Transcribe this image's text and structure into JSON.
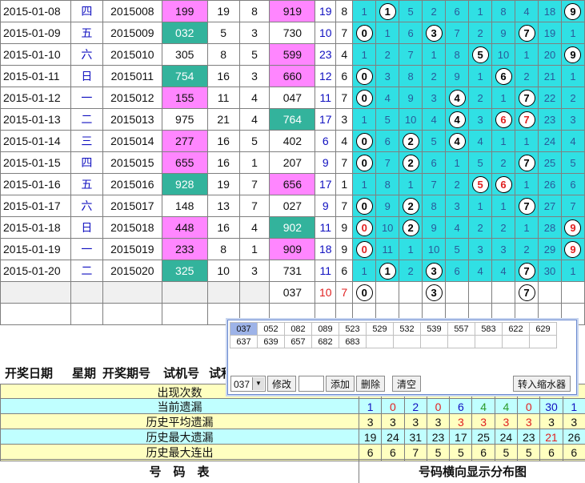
{
  "rows": [
    {
      "date": "2015-01-08",
      "week": "四",
      "issue": "2015008",
      "test": "199",
      "test_bg": "pink",
      "s": "19",
      "k": "8",
      "draw": "919",
      "draw_bg": "pink",
      "ds": "19",
      "dk": "8",
      "dist": [
        {
          "v": "1"
        },
        {
          "v": "1",
          "c": 1
        },
        {
          "v": "5"
        },
        {
          "v": "2"
        },
        {
          "v": "6"
        },
        {
          "v": "1"
        },
        {
          "v": "8"
        },
        {
          "v": "4"
        },
        {
          "v": "18"
        },
        {
          "v": "9",
          "c": 1
        }
      ]
    },
    {
      "date": "2015-01-09",
      "week": "五",
      "issue": "2015009",
      "test": "032",
      "test_bg": "teal",
      "s": "5",
      "k": "3",
      "draw": "730",
      "draw_bg": "",
      "ds": "10",
      "dk": "7",
      "dist": [
        {
          "v": "0",
          "c": 1
        },
        {
          "v": "1"
        },
        {
          "v": "6"
        },
        {
          "v": "3",
          "c": 1
        },
        {
          "v": "7"
        },
        {
          "v": "2"
        },
        {
          "v": "9"
        },
        {
          "v": "7",
          "c": 1
        },
        {
          "v": "19"
        },
        {
          "v": "1"
        }
      ]
    },
    {
      "date": "2015-01-10",
      "week": "六",
      "issue": "2015010",
      "test": "305",
      "test_bg": "",
      "s": "8",
      "k": "5",
      "draw": "599",
      "draw_bg": "pink",
      "ds": "23",
      "dk": "4",
      "dist": [
        {
          "v": "1"
        },
        {
          "v": "2"
        },
        {
          "v": "7"
        },
        {
          "v": "1"
        },
        {
          "v": "8"
        },
        {
          "v": "5",
          "c": 1
        },
        {
          "v": "10"
        },
        {
          "v": "1"
        },
        {
          "v": "20"
        },
        {
          "v": "9",
          "c": 1
        }
      ]
    },
    {
      "date": "2015-01-11",
      "week": "日",
      "issue": "2015011",
      "test": "754",
      "test_bg": "teal",
      "s": "16",
      "k": "3",
      "draw": "660",
      "draw_bg": "pink",
      "ds": "12",
      "dk": "6",
      "dist": [
        {
          "v": "0",
          "c": 1
        },
        {
          "v": "3"
        },
        {
          "v": "8"
        },
        {
          "v": "2"
        },
        {
          "v": "9"
        },
        {
          "v": "1"
        },
        {
          "v": "6",
          "c": 1
        },
        {
          "v": "2"
        },
        {
          "v": "21"
        },
        {
          "v": "1"
        }
      ]
    },
    {
      "date": "2015-01-12",
      "week": "一",
      "issue": "2015012",
      "test": "155",
      "test_bg": "pink",
      "s": "11",
      "k": "4",
      "draw": "047",
      "draw_bg": "",
      "ds": "11",
      "dk": "7",
      "dist": [
        {
          "v": "0",
          "c": 1
        },
        {
          "v": "4"
        },
        {
          "v": "9"
        },
        {
          "v": "3"
        },
        {
          "v": "4",
          "c": 1
        },
        {
          "v": "2"
        },
        {
          "v": "1"
        },
        {
          "v": "7",
          "c": 1
        },
        {
          "v": "22"
        },
        {
          "v": "2"
        }
      ]
    },
    {
      "date": "2015-01-13",
      "week": "二",
      "issue": "2015013",
      "test": "975",
      "test_bg": "",
      "s": "21",
      "k": "4",
      "draw": "764",
      "draw_bg": "teal",
      "ds": "17",
      "dk": "3",
      "dist": [
        {
          "v": "1"
        },
        {
          "v": "5"
        },
        {
          "v": "10"
        },
        {
          "v": "4"
        },
        {
          "v": "4",
          "c": 1
        },
        {
          "v": "3"
        },
        {
          "v": "6",
          "c": 1,
          "r": 1
        },
        {
          "v": "7",
          "c": 1,
          "r": 1
        },
        {
          "v": "23"
        },
        {
          "v": "3"
        }
      ]
    },
    {
      "date": "2015-01-14",
      "week": "三",
      "issue": "2015014",
      "test": "277",
      "test_bg": "pink",
      "s": "16",
      "k": "5",
      "draw": "402",
      "draw_bg": "",
      "ds": "6",
      "dk": "4",
      "dist": [
        {
          "v": "0",
          "c": 1
        },
        {
          "v": "6"
        },
        {
          "v": "2",
          "c": 1
        },
        {
          "v": "5"
        },
        {
          "v": "4",
          "c": 1
        },
        {
          "v": "4"
        },
        {
          "v": "1"
        },
        {
          "v": "1"
        },
        {
          "v": "24"
        },
        {
          "v": "4"
        }
      ]
    },
    {
      "date": "2015-01-15",
      "week": "四",
      "issue": "2015015",
      "test": "655",
      "test_bg": "pink",
      "s": "16",
      "k": "1",
      "draw": "207",
      "draw_bg": "",
      "ds": "9",
      "dk": "7",
      "dist": [
        {
          "v": "0",
          "c": 1
        },
        {
          "v": "7"
        },
        {
          "v": "2",
          "c": 1
        },
        {
          "v": "6"
        },
        {
          "v": "1"
        },
        {
          "v": "5"
        },
        {
          "v": "2"
        },
        {
          "v": "7",
          "c": 1
        },
        {
          "v": "25"
        },
        {
          "v": "5"
        }
      ]
    },
    {
      "date": "2015-01-16",
      "week": "五",
      "issue": "2015016",
      "test": "928",
      "test_bg": "teal",
      "s": "19",
      "k": "7",
      "draw": "656",
      "draw_bg": "pink",
      "ds": "17",
      "dk": "1",
      "dist": [
        {
          "v": "1"
        },
        {
          "v": "8"
        },
        {
          "v": "1"
        },
        {
          "v": "7"
        },
        {
          "v": "2"
        },
        {
          "v": "5",
          "c": 1,
          "r": 1
        },
        {
          "v": "6",
          "c": 1,
          "r": 1
        },
        {
          "v": "1"
        },
        {
          "v": "26"
        },
        {
          "v": "6"
        }
      ]
    },
    {
      "date": "2015-01-17",
      "week": "六",
      "issue": "2015017",
      "test": "148",
      "test_bg": "",
      "s": "13",
      "k": "7",
      "draw": "027",
      "draw_bg": "",
      "ds": "9",
      "dk": "7",
      "dist": [
        {
          "v": "0",
          "c": 1
        },
        {
          "v": "9"
        },
        {
          "v": "2",
          "c": 1
        },
        {
          "v": "8"
        },
        {
          "v": "3"
        },
        {
          "v": "1"
        },
        {
          "v": "1"
        },
        {
          "v": "7",
          "c": 1
        },
        {
          "v": "27"
        },
        {
          "v": "7"
        }
      ]
    },
    {
      "date": "2015-01-18",
      "week": "日",
      "issue": "2015018",
      "test": "448",
      "test_bg": "pink",
      "s": "16",
      "k": "4",
      "draw": "902",
      "draw_bg": "teal",
      "ds": "11",
      "dk": "9",
      "dist": [
        {
          "v": "0",
          "c": 1,
          "r": 1
        },
        {
          "v": "10"
        },
        {
          "v": "2",
          "c": 1
        },
        {
          "v": "9"
        },
        {
          "v": "4"
        },
        {
          "v": "2"
        },
        {
          "v": "2"
        },
        {
          "v": "1"
        },
        {
          "v": "28"
        },
        {
          "v": "9",
          "c": 1,
          "r": 1
        }
      ]
    },
    {
      "date": "2015-01-19",
      "week": "一",
      "issue": "2015019",
      "test": "233",
      "test_bg": "pink",
      "s": "8",
      "k": "1",
      "draw": "909",
      "draw_bg": "pink",
      "ds": "18",
      "dk": "9",
      "dist": [
        {
          "v": "0",
          "c": 1,
          "r": 1
        },
        {
          "v": "11"
        },
        {
          "v": "1"
        },
        {
          "v": "10"
        },
        {
          "v": "5"
        },
        {
          "v": "3"
        },
        {
          "v": "3"
        },
        {
          "v": "2"
        },
        {
          "v": "29"
        },
        {
          "v": "9",
          "c": 1,
          "r": 1
        }
      ]
    },
    {
      "date": "2015-01-20",
      "week": "二",
      "issue": "2015020",
      "test": "325",
      "test_bg": "teal",
      "s": "10",
      "k": "3",
      "draw": "731",
      "draw_bg": "",
      "ds": "11",
      "dk": "6",
      "dist": [
        {
          "v": "1"
        },
        {
          "v": "1",
          "c": 1
        },
        {
          "v": "2"
        },
        {
          "v": "3",
          "c": 1
        },
        {
          "v": "6"
        },
        {
          "v": "4"
        },
        {
          "v": "4"
        },
        {
          "v": "7",
          "c": 1
        },
        {
          "v": "30"
        },
        {
          "v": "1"
        }
      ]
    }
  ],
  "pending": {
    "draw": "037",
    "ds": "10",
    "dk": "7",
    "circles": {
      "0": "0",
      "3": "3",
      "7": "7"
    }
  },
  "headers": {
    "date": "开奖日期",
    "week": "星期",
    "issue": "开奖期号",
    "test": "试机号",
    "sum_cut": "试和"
  },
  "stats": [
    {
      "label": "出现次数",
      "values": [
        "",
        "",
        "",
        "",
        "",
        "",
        "",
        "",
        "",
        ""
      ]
    },
    {
      "label": "当前遗漏",
      "values": [
        "1",
        "0",
        "2",
        "0",
        "6",
        "4",
        "4",
        "0",
        "30",
        "1"
      ]
    },
    {
      "label": "历史平均遗漏",
      "values": [
        "3",
        "3",
        "3",
        "3",
        "3",
        "3",
        "3",
        "3",
        "3",
        "3"
      ]
    },
    {
      "label": "历史最大遗漏",
      "values": [
        "19",
        "24",
        "31",
        "23",
        "17",
        "25",
        "24",
        "23",
        "21",
        "26"
      ]
    },
    {
      "label": "历史最大连出",
      "values": [
        "6",
        "6",
        "7",
        "5",
        "5",
        "6",
        "5",
        "5",
        "6",
        "6"
      ]
    }
  ],
  "footer": {
    "left": "号　码　表",
    "right": "号码横向显示分布图"
  },
  "popup": {
    "numbers_row1": [
      "037",
      "052",
      "082",
      "089",
      "523",
      "529",
      "532",
      "539",
      "557",
      "583",
      "622",
      "629"
    ],
    "numbers_row2": [
      "637",
      "639",
      "657",
      "682",
      "683"
    ],
    "select_value": "037",
    "buttons": {
      "modify": "修改",
      "add": "添加",
      "delete": "删除",
      "clear": "清空",
      "transfer": "转入缩水器"
    }
  },
  "colors": {
    "pink": "#ff86ff",
    "teal": "#33b39c",
    "cyan": "#30e0e4",
    "stat_yellow": "#ffffc0",
    "stat_green": "#c0ffc0",
    "red": "#e02020",
    "blue": "#1010c0"
  }
}
